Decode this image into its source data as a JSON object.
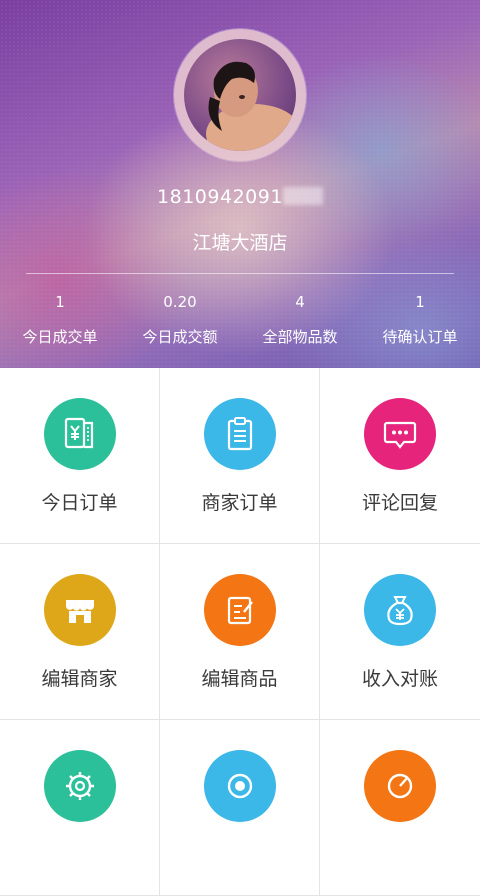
{
  "profile": {
    "phone_visible": "1810942091",
    "store_name": "江塘大酒店"
  },
  "stats": [
    {
      "value": "1",
      "label": "今日成交单"
    },
    {
      "value": "0.20",
      "label": "今日成交额"
    },
    {
      "value": "4",
      "label": "全部物品数"
    },
    {
      "value": "1",
      "label": "待确认订单"
    }
  ],
  "menu": [
    {
      "label": "今日订单",
      "icon": "yuan-receipt-icon",
      "color": "#2cc09a"
    },
    {
      "label": "商家订单",
      "icon": "clipboard-icon",
      "color": "#3bb8e8"
    },
    {
      "label": "评论回复",
      "icon": "chat-bubble-icon",
      "color": "#e6247c"
    },
    {
      "label": "编辑商家",
      "icon": "storefront-icon",
      "color": "#dea71a"
    },
    {
      "label": "编辑商品",
      "icon": "edit-note-icon",
      "color": "#f47514"
    },
    {
      "label": "收入对账",
      "icon": "money-bag-icon",
      "color": "#3bb8e8"
    },
    {
      "label": "",
      "icon": "gear-icon",
      "color": "#2cc09a"
    },
    {
      "label": "",
      "icon": "eye-icon",
      "color": "#3bb8e8"
    },
    {
      "label": "",
      "icon": "gauge-icon",
      "color": "#f47514"
    }
  ]
}
